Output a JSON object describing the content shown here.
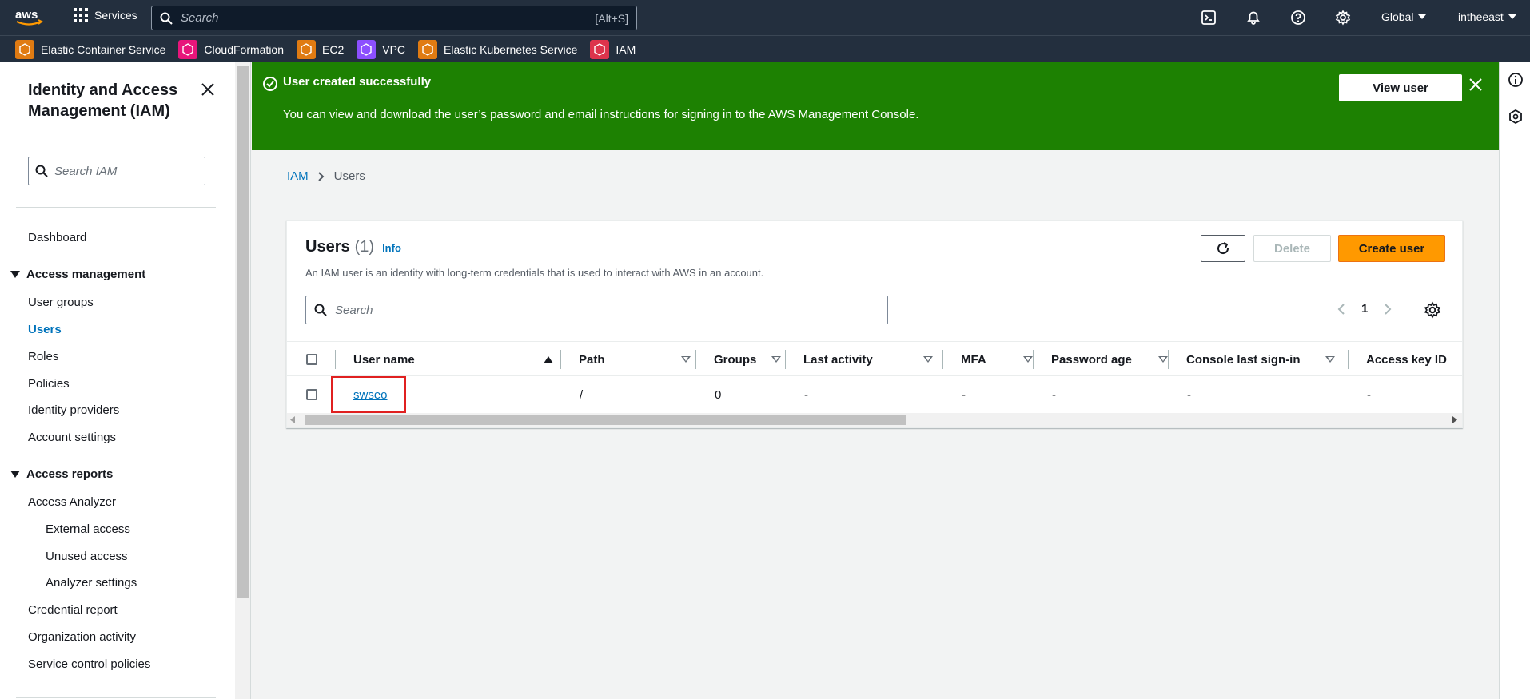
{
  "topnav": {
    "services_label": "Services",
    "search_placeholder": "Search",
    "search_shortcut": "[Alt+S]",
    "region": "Global",
    "account": "intheeast"
  },
  "favorites": [
    {
      "label": "Elastic Container Service",
      "color": "#e07b12"
    },
    {
      "label": "CloudFormation",
      "color": "#e7157b"
    },
    {
      "label": "EC2",
      "color": "#e07b12"
    },
    {
      "label": "VPC",
      "color": "#8c4fff"
    },
    {
      "label": "Elastic Kubernetes Service",
      "color": "#e07b12"
    },
    {
      "label": "IAM",
      "color": "#dd344c"
    }
  ],
  "sidebar": {
    "title": "Identity and Access Management (IAM)",
    "search_placeholder": "Search IAM",
    "dashboard": "Dashboard",
    "access_management": "Access management",
    "access_items": [
      "User groups",
      "Users",
      "Roles",
      "Policies",
      "Identity providers",
      "Account settings"
    ],
    "access_reports": "Access reports",
    "access_analyzer": "Access Analyzer",
    "analyzer_items": [
      "External access",
      "Unused access",
      "Analyzer settings"
    ],
    "report_items": [
      "Credential report",
      "Organization activity",
      "Service control policies"
    ]
  },
  "flash": {
    "title": "User created successfully",
    "message": "You can view and download the user’s password and email instructions for signing in to the AWS Management Console.",
    "button": "View user"
  },
  "breadcrumb": {
    "root": "IAM",
    "current": "Users"
  },
  "users_panel": {
    "title": "Users",
    "count": "(1)",
    "info": "Info",
    "description": "An IAM user is an identity with long-term credentials that is used to interact with AWS in an account.",
    "delete_label": "Delete",
    "create_label": "Create user",
    "search_placeholder": "Search",
    "page": "1",
    "columns": [
      "User name",
      "Path",
      "Groups",
      "Last activity",
      "MFA",
      "Password age",
      "Console last sign-in",
      "Access key ID"
    ],
    "rows": [
      {
        "user_name": "swseo",
        "path": "/",
        "groups": "0",
        "last_activity": "-",
        "mfa": "-",
        "password_age": "-",
        "console_last_sign_in": "-",
        "access_key_id": "-"
      }
    ]
  },
  "colors": {
    "accent": "#0073bb",
    "success": "#1d8102",
    "primary_button": "#ff9900",
    "nav_bg": "#232f3e"
  }
}
